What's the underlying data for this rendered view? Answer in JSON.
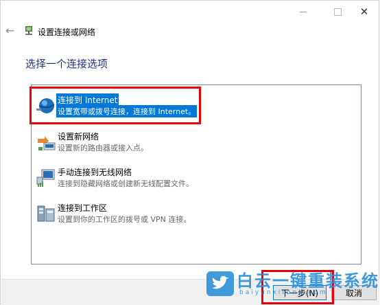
{
  "window": {
    "title": "设置连接或网络",
    "back_icon": "back-arrow-icon",
    "minimize_icon": "minimize-icon",
    "maximize_icon": "maximize-icon",
    "close_icon": "close-icon"
  },
  "heading": "选择一个连接选项",
  "options": [
    {
      "icon": "globe-network-icon",
      "title": "连接到 Internet",
      "desc": "设置宽带或拨号连接，连接到 Internet。",
      "selected": true
    },
    {
      "icon": "new-network-icon",
      "title": "设置新网络",
      "desc": "设置新的路由器或接入点。",
      "selected": false
    },
    {
      "icon": "wireless-network-icon",
      "title": "手动连接到无线网络",
      "desc": "连接到隐藏网络或创建新无线配置文件。",
      "selected": false
    },
    {
      "icon": "workplace-icon",
      "title": "连接到工作区",
      "desc": "设置到你的工作区的拨号或 VPN 连接。",
      "selected": false
    }
  ],
  "buttons": {
    "next": "下一步(N)",
    "cancel": "取消"
  },
  "watermark": {
    "name": "白云一键重装系统",
    "url": "baiyunxitong.com",
    "logo_icon": "twitter-bird-icon"
  },
  "colors": {
    "accent": "#0078d7",
    "heading": "#1e3287",
    "highlight": "#e8000b",
    "watermark": "#2b8fd8"
  }
}
